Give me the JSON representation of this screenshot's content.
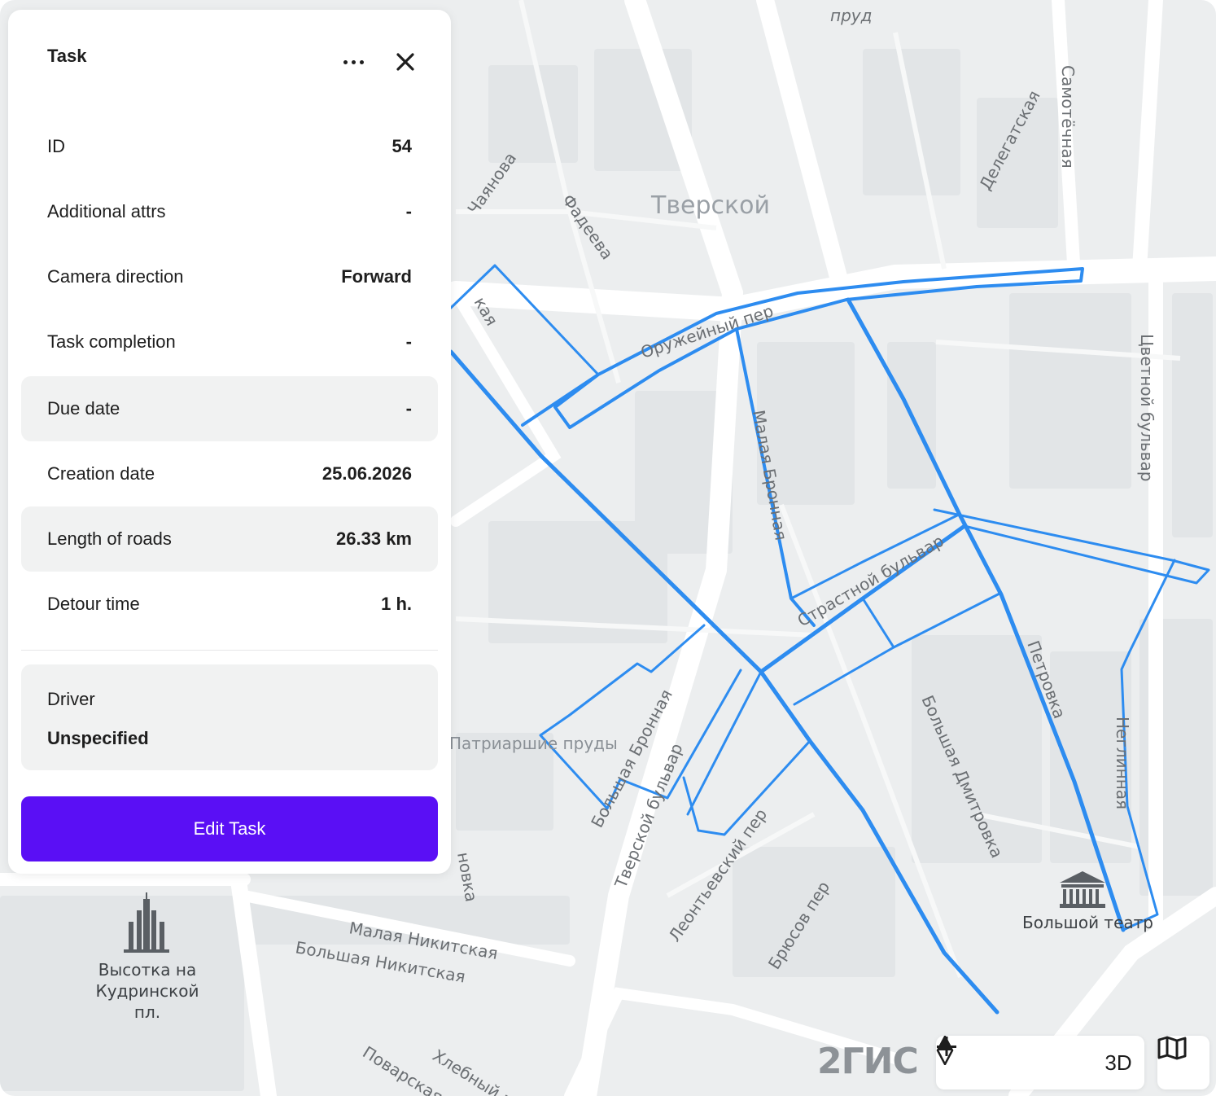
{
  "panel": {
    "title": "Task",
    "rows": [
      {
        "label": "ID",
        "value": "54"
      },
      {
        "label": "Additional attrs",
        "value": "-"
      },
      {
        "label": "Camera direction",
        "value": "Forward"
      },
      {
        "label": "Task completion",
        "value": "-"
      },
      {
        "label": "Due date",
        "value": "-"
      },
      {
        "label": "Creation date",
        "value": "25.06.2026"
      },
      {
        "label": "Length of roads",
        "value": "26.33 km"
      },
      {
        "label": "Detour time",
        "value": "1 h."
      }
    ],
    "driver": {
      "label": "Driver",
      "value": "Unspecified"
    },
    "edit_button_label": "Edit Task"
  },
  "map": {
    "district": "Тверской",
    "street_labels": [
      "пруд",
      "Самотёчная",
      "Делегатская",
      "Чаянова",
      "Фадеева",
      "кая",
      "Оружейный пер",
      "Цветной бульвар",
      "Страстной бульвар",
      "Большая Дмитровка",
      "Петровка",
      "Неглинная",
      "Малая Бронная",
      "Большая Бронная",
      "Тверской бульвар",
      "Леонтьевский пер",
      "Брюсов пер",
      "Малая Никитская",
      "Большая Никитская",
      "Поварская",
      "Хлебный п",
      "новка"
    ],
    "poi_labels": [
      "Патриаршие пруды",
      "Высотка на Кудринской пл.",
      "Большой театр"
    ],
    "brand": "2ГИС",
    "route_color": "#2d8cf0"
  },
  "controls": {
    "zoom_out": "−",
    "zoom_in": "+",
    "mode_3d": "3D"
  }
}
